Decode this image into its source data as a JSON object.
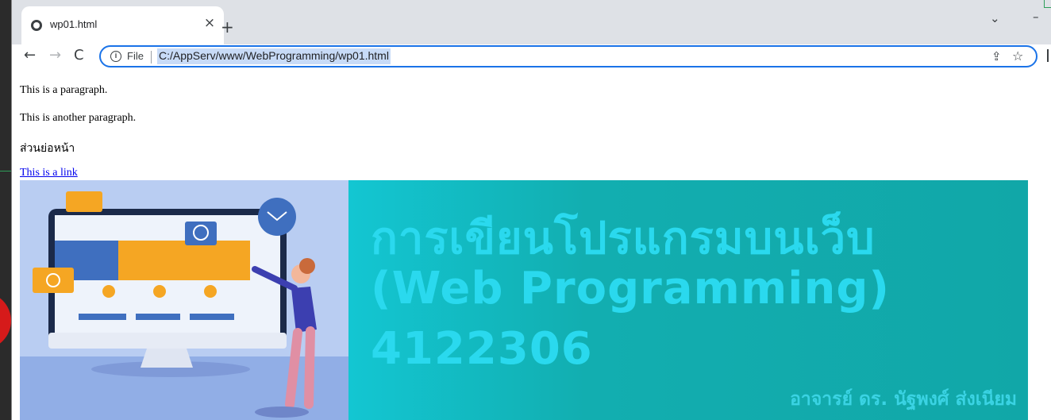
{
  "browser": {
    "tab": {
      "title": "wp01.html",
      "close_glyph": "×",
      "favicon": "globe-icon"
    },
    "new_tab_glyph": "+",
    "window_controls": {
      "tab_search_glyph": "⌄",
      "minimize_glyph": "–"
    },
    "toolbar": {
      "back_glyph": "←",
      "forward_glyph": "→",
      "reload_glyph": "C",
      "info_glyph": "i",
      "file_label": "File",
      "url": "C:/AppServ/www/WebProgramming/wp01.html",
      "share_glyph": "⇪",
      "star_glyph": "☆"
    },
    "accent_color": "#1a73e8"
  },
  "page": {
    "paragraph1": "This is a paragraph.",
    "paragraph2": "This is another paragraph.",
    "thai_heading": "ส่วนย่อหน้า",
    "link_text": "This is a link",
    "link_color": "#0000ee",
    "banner": {
      "title_line1": "การเขียนโปรแกรมบนเว็บ",
      "title_line2": "(Web Programming)",
      "course_code": "4122306",
      "author": "อาจารย์ ดร. นัฐพงศ์ ส่งเนียม",
      "bg_color": "#11a7a8",
      "text_color": "#2ad9ee"
    }
  }
}
